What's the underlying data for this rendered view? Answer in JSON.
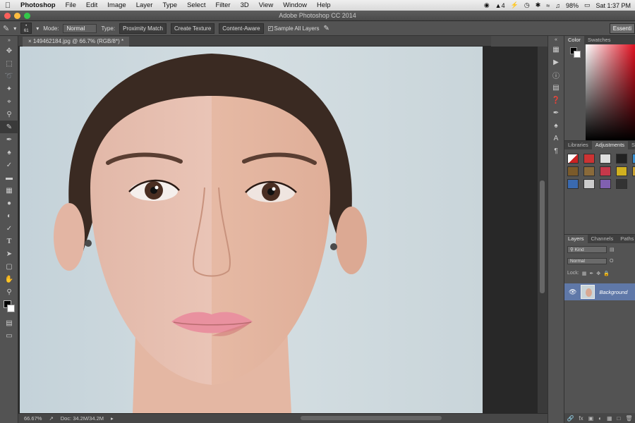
{
  "menubar": {
    "app_name": "Photoshop",
    "items": [
      "File",
      "Edit",
      "Image",
      "Layer",
      "Type",
      "Select",
      "Filter",
      "3D",
      "View",
      "Window",
      "Help"
    ],
    "status_adobe_count": "4",
    "battery": "98%",
    "clock": "Sat 1:37 PM"
  },
  "window": {
    "title": "Adobe Photoshop CC 2014"
  },
  "options": {
    "brush_size": "61",
    "mode_label": "Mode:",
    "mode_value": "Normal",
    "type_label": "Type:",
    "type_proximity": "Proximity Match",
    "type_create_texture": "Create Texture",
    "type_content_aware": "Content-Aware",
    "sample_all_layers": "Sample All Layers",
    "workspace": "Essenti"
  },
  "document": {
    "tab_title": "149462184.jpg @ 66.7% (RGB/8*) *"
  },
  "statusbar": {
    "zoom": "66.67%",
    "doc_size": "Doc: 34.2M/34.2M"
  },
  "panels": {
    "color_tabs": [
      "Color",
      "Swatches"
    ],
    "adjust_tabs": [
      "Libraries",
      "Adjustments",
      "S"
    ],
    "layers_tabs": [
      "Layers",
      "Channels",
      "Paths"
    ],
    "kind_label": "Kind",
    "blend_mode": "Normal",
    "opacity_prefix": "O",
    "lock_label": "Lock:",
    "layer_name": "Background"
  },
  "colors": {
    "foreground": "#000000",
    "background": "#ffffff",
    "layer_selected": "#5f78a8"
  }
}
